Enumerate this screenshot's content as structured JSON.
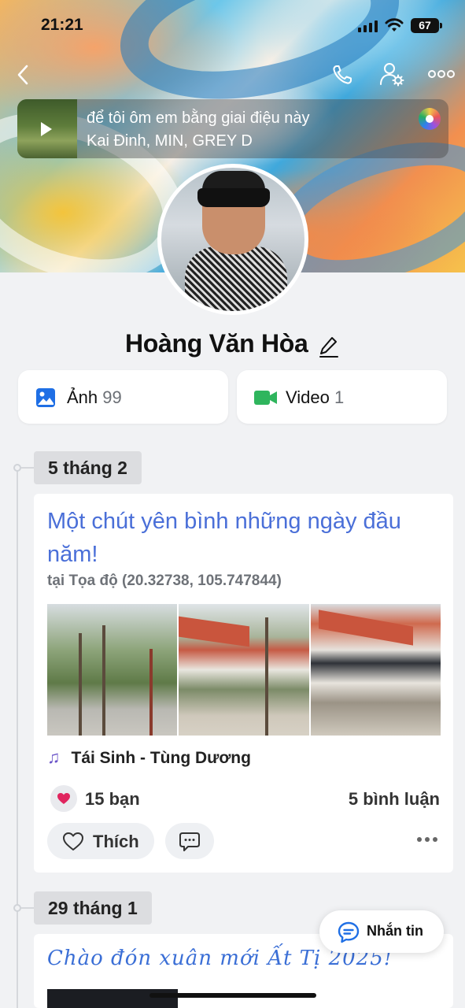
{
  "status_bar": {
    "time": "21:21",
    "battery": "67"
  },
  "music": {
    "title": "để tôi ôm em bằng giai điệu này",
    "artists": "Kai Đinh, MIN, GREY D"
  },
  "profile": {
    "name": "Hoàng Văn Hòa"
  },
  "stats": {
    "photos": {
      "label": "Ảnh",
      "count": "99"
    },
    "videos": {
      "label": "Video",
      "count": "1"
    }
  },
  "posts": [
    {
      "date": "5 tháng 2",
      "title": "Một chút yên bình những ngày đầu năm!",
      "location": "tại Tọa độ (20.32738, 105.747844)",
      "song": "Tái Sinh - Tùng Dương",
      "reactions": "15 bạn",
      "comments": "5 bình luận",
      "like_label": "Thích"
    },
    {
      "date": "29 tháng 1",
      "title": "Chào đón xuân mới Ất Tị 2025!"
    }
  ],
  "message_button": {
    "label": "Nhắn tin"
  },
  "colors": {
    "accent": "#4a6fd8",
    "background": "#f1f2f4",
    "like_heart": "#e0245e"
  }
}
